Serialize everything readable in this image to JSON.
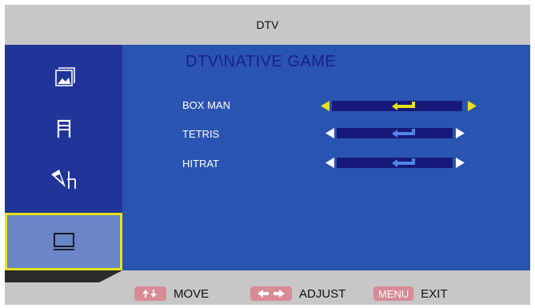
{
  "window": {
    "title": "DTV"
  },
  "sidebar": {
    "items": [
      {
        "name": "picture",
        "icon": "picture-icon",
        "selected": false
      },
      {
        "name": "sound",
        "icon": "music-note-icon",
        "selected": false
      },
      {
        "name": "setup",
        "icon": "pen-icon",
        "selected": false
      },
      {
        "name": "tv",
        "icon": "monitor-icon",
        "selected": true
      }
    ]
  },
  "main": {
    "heading": "DTV\\NATIVE GAME",
    "games": [
      {
        "label": "BOX MAN",
        "selected": true
      },
      {
        "label": "TETRIS",
        "selected": false
      },
      {
        "label": "HITRAT",
        "selected": false
      }
    ]
  },
  "footer": {
    "move_label": "MOVE",
    "adjust_label": "ADJUST",
    "menu_key": "MENU",
    "exit_label": "EXIT"
  },
  "colors": {
    "sidebar_bg": "#20349a",
    "panel_bg": "#2a54b2",
    "highlight": "#e6e21a",
    "key_pill": "#d88a95"
  }
}
